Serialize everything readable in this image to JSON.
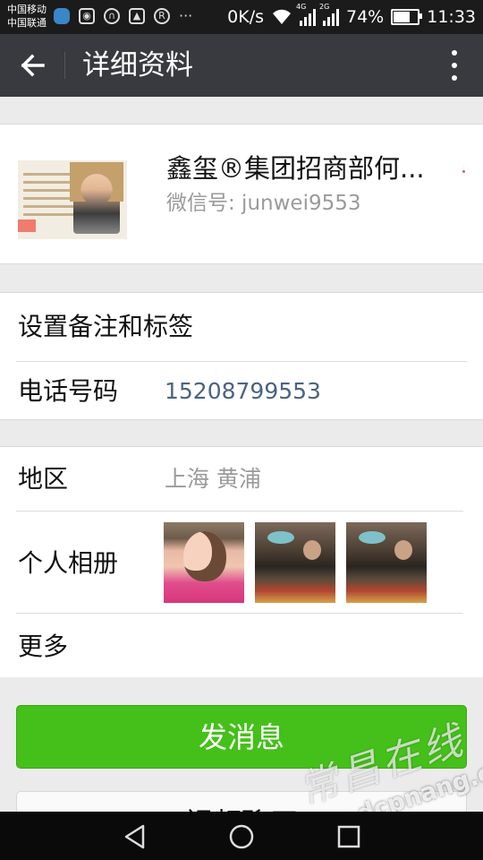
{
  "status_bar": {
    "carrier_1": "中国移动",
    "carrier_2": "中国联通",
    "left_icons": [
      "app-notification-icon",
      "camera-icon",
      "vpn-lock-icon",
      "image-icon",
      "registered-icon"
    ],
    "more_indicator": "···",
    "net_speed": "0K/s",
    "signal_1_tag": "4G",
    "signal_2_tag": "2G",
    "battery_percent": "74%",
    "battery_level": 0.74,
    "time": "11:33"
  },
  "title_bar": {
    "title": "详细资料"
  },
  "profile": {
    "name": "鑫玺®集团招商部何...",
    "wechat_id": "微信号: junwei9553"
  },
  "section2": {
    "remark_label": "设置备注和标签",
    "phone_label": "电话号码",
    "phone_value": "15208799553"
  },
  "section3": {
    "region_label": "地区",
    "region_value": "上海  黄浦",
    "album_label": "个人相册",
    "more_label": "更多"
  },
  "buttons": {
    "send_message": "发消息",
    "call": "视频聊天"
  },
  "watermark": {
    "cn": "常昌在线",
    "url": "www.dcpnang.org"
  },
  "colors": {
    "title_bar": "#393a3f",
    "accent_green": "#45c01a",
    "phone_text": "#4a6382",
    "muted_text": "#9a9a9a"
  }
}
